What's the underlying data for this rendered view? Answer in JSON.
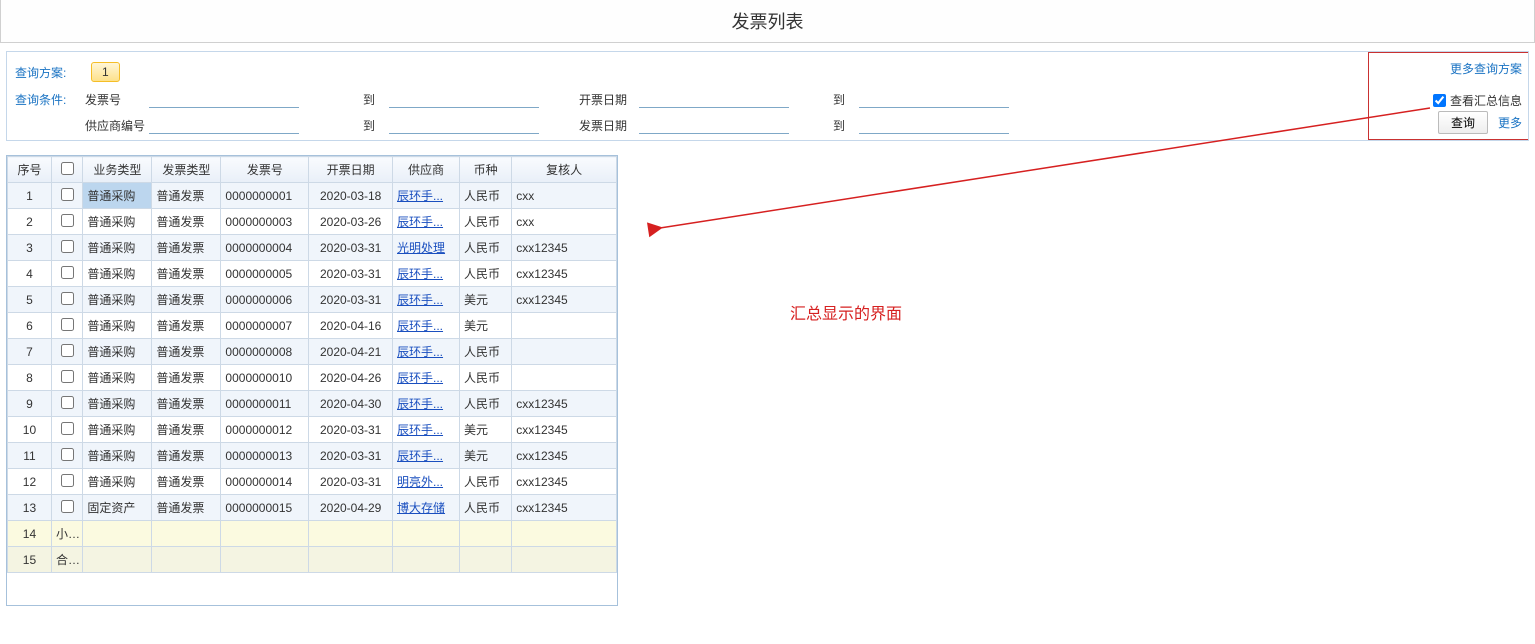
{
  "title": "发票列表",
  "query": {
    "scheme_label": "查询方案:",
    "scheme_value": "1",
    "cond_label": "查询条件:",
    "invoice_no_label": "发票号",
    "supplier_no_label": "供应商编号",
    "to_label": "到",
    "billing_date_label": "开票日期",
    "invoice_date_label": "发票日期",
    "more_scheme": "更多查询方案",
    "view_summary_label": "查看汇总信息",
    "view_summary_checked": true,
    "search_btn": "查询",
    "more_link": "更多"
  },
  "annotation": "汇总显示的界面",
  "table": {
    "headers": {
      "seq": "序号",
      "biz": "业务类型",
      "invtype": "发票类型",
      "invno": "发票号",
      "date": "开票日期",
      "supplier": "供应商",
      "currency": "币种",
      "reviewer": "复核人"
    },
    "rows": [
      {
        "seq": "1",
        "biz": "普通采购",
        "invtype": "普通发票",
        "invno": "0000000001",
        "date": "2020-03-18",
        "supplier": "辰环手...",
        "currency": "人民币",
        "reviewer": "cxx"
      },
      {
        "seq": "2",
        "biz": "普通采购",
        "invtype": "普通发票",
        "invno": "0000000003",
        "date": "2020-03-26",
        "supplier": "辰环手...",
        "currency": "人民币",
        "reviewer": "cxx"
      },
      {
        "seq": "3",
        "biz": "普通采购",
        "invtype": "普通发票",
        "invno": "0000000004",
        "date": "2020-03-31",
        "supplier": "光明处理",
        "currency": "人民币",
        "reviewer": "cxx12345"
      },
      {
        "seq": "4",
        "biz": "普通采购",
        "invtype": "普通发票",
        "invno": "0000000005",
        "date": "2020-03-31",
        "supplier": "辰环手...",
        "currency": "人民币",
        "reviewer": "cxx12345"
      },
      {
        "seq": "5",
        "biz": "普通采购",
        "invtype": "普通发票",
        "invno": "0000000006",
        "date": "2020-03-31",
        "supplier": "辰环手...",
        "currency": "美元",
        "reviewer": "cxx12345"
      },
      {
        "seq": "6",
        "biz": "普通采购",
        "invtype": "普通发票",
        "invno": "0000000007",
        "date": "2020-04-16",
        "supplier": "辰环手...",
        "currency": "美元",
        "reviewer": ""
      },
      {
        "seq": "7",
        "biz": "普通采购",
        "invtype": "普通发票",
        "invno": "0000000008",
        "date": "2020-04-21",
        "supplier": "辰环手...",
        "currency": "人民币",
        "reviewer": ""
      },
      {
        "seq": "8",
        "biz": "普通采购",
        "invtype": "普通发票",
        "invno": "0000000010",
        "date": "2020-04-26",
        "supplier": "辰环手...",
        "currency": "人民币",
        "reviewer": ""
      },
      {
        "seq": "9",
        "biz": "普通采购",
        "invtype": "普通发票",
        "invno": "0000000011",
        "date": "2020-04-30",
        "supplier": "辰环手...",
        "currency": "人民币",
        "reviewer": "cxx12345"
      },
      {
        "seq": "10",
        "biz": "普通采购",
        "invtype": "普通发票",
        "invno": "0000000012",
        "date": "2020-03-31",
        "supplier": "辰环手...",
        "currency": "美元",
        "reviewer": "cxx12345"
      },
      {
        "seq": "11",
        "biz": "普通采购",
        "invtype": "普通发票",
        "invno": "0000000013",
        "date": "2020-03-31",
        "supplier": "辰环手...",
        "currency": "美元",
        "reviewer": "cxx12345"
      },
      {
        "seq": "12",
        "biz": "普通采购",
        "invtype": "普通发票",
        "invno": "0000000014",
        "date": "2020-03-31",
        "supplier": "明亮外...",
        "currency": "人民币",
        "reviewer": "cxx12345"
      },
      {
        "seq": "13",
        "biz": "固定资产",
        "invtype": "普通发票",
        "invno": "0000000015",
        "date": "2020-04-29",
        "supplier": "博大存储",
        "currency": "人民币",
        "reviewer": "cxx12345"
      }
    ],
    "subtotal": {
      "seq": "14",
      "label": "小计"
    },
    "total": {
      "seq": "15",
      "label": "合计"
    }
  }
}
